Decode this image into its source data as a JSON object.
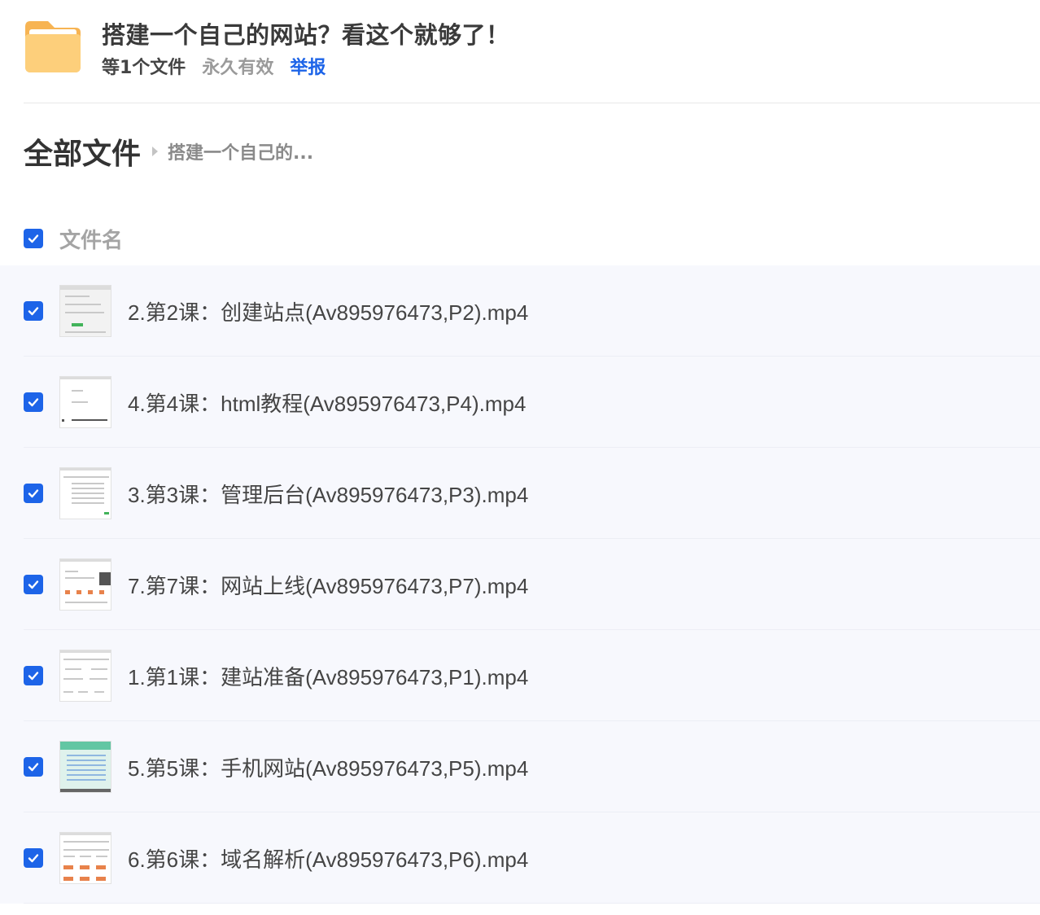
{
  "share": {
    "title": "搭建一个自己的网站？看这个就够了！",
    "file_count": "等1个文件",
    "validity": "永久有效",
    "report_label": "举报",
    "icon": "folder-icon"
  },
  "breadcrumb": {
    "root": "全部文件",
    "current": "搭建一个自己的..."
  },
  "list": {
    "header_label": "文件名",
    "select_all_checked": true,
    "files": [
      {
        "name": "2.第2课：创建站点(Av895976473,P2).mp4",
        "checked": true
      },
      {
        "name": "4.第4课：html教程(Av895976473,P4).mp4",
        "checked": true
      },
      {
        "name": "3.第3课：管理后台(Av895976473,P3).mp4",
        "checked": true
      },
      {
        "name": "7.第7课：网站上线(Av895976473,P7).mp4",
        "checked": true
      },
      {
        "name": "1.第1课：建站准备(Av895976473,P1).mp4",
        "checked": true
      },
      {
        "name": "5.第5课：手机网站(Av895976473,P5).mp4",
        "checked": true
      },
      {
        "name": "6.第6课：域名解析(Av895976473,P6).mp4",
        "checked": true
      }
    ]
  },
  "colors": {
    "accent": "#1d64e8",
    "folder": "#fcc56b",
    "list_bg": "#f7f8fd"
  }
}
